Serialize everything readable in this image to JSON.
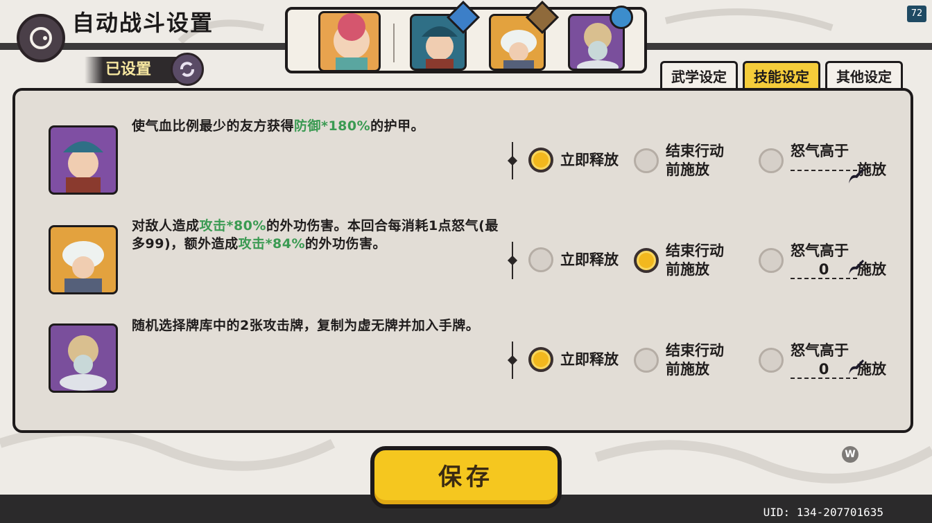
{
  "header": {
    "title": "自动战斗设置",
    "settled_label": "已设置",
    "fps": "72"
  },
  "tabs": [
    {
      "label": "武学设定",
      "active": false
    },
    {
      "label": "技能设定",
      "active": true
    },
    {
      "label": "其他设定",
      "active": false
    }
  ],
  "colors": {
    "accent_yellow": "#f5c71f",
    "highlight_green": "#3a9a52",
    "panel_bg": "#e2ddd6",
    "outline": "#1d1a1b"
  },
  "team": {
    "portraits": [
      "leader-portrait",
      "hero-shield-portrait",
      "hero-sword-portrait",
      "hero-heal-portrait"
    ]
  },
  "skills": [
    {
      "desc_parts": [
        "使气血比例最少的友方获得",
        "防御*180%",
        "的护甲。"
      ],
      "options": {
        "immediate": "立即释放",
        "before_end_1": "结束行动",
        "before_end_2": "前施放",
        "rage_1": "怒气高于",
        "rage_value": "",
        "rage_2": "施放"
      },
      "selected": "immediate"
    },
    {
      "desc_parts": [
        "对敌人造成",
        "攻击*80%",
        "的外功伤害。本回合每消耗1点怒气(最多99)，额外造成",
        "攻击*84%",
        "的外功伤害。"
      ],
      "options": {
        "immediate": "立即释放",
        "before_end_1": "结束行动",
        "before_end_2": "前施放",
        "rage_1": "怒气高于",
        "rage_value": "0",
        "rage_2": "施放"
      },
      "selected": "before_end"
    },
    {
      "desc_parts": [
        "随机选择牌库中的2张攻击牌，复制为虚无牌并加入手牌。"
      ],
      "options": {
        "immediate": "立即释放",
        "before_end_1": "结束行动",
        "before_end_2": "前施放",
        "rage_1": "怒气高于",
        "rage_value": "0",
        "rage_2": "施放"
      },
      "selected": "immediate"
    }
  ],
  "save_label": "保存",
  "w_badge": "W",
  "uid": "UID: 134-207701635"
}
